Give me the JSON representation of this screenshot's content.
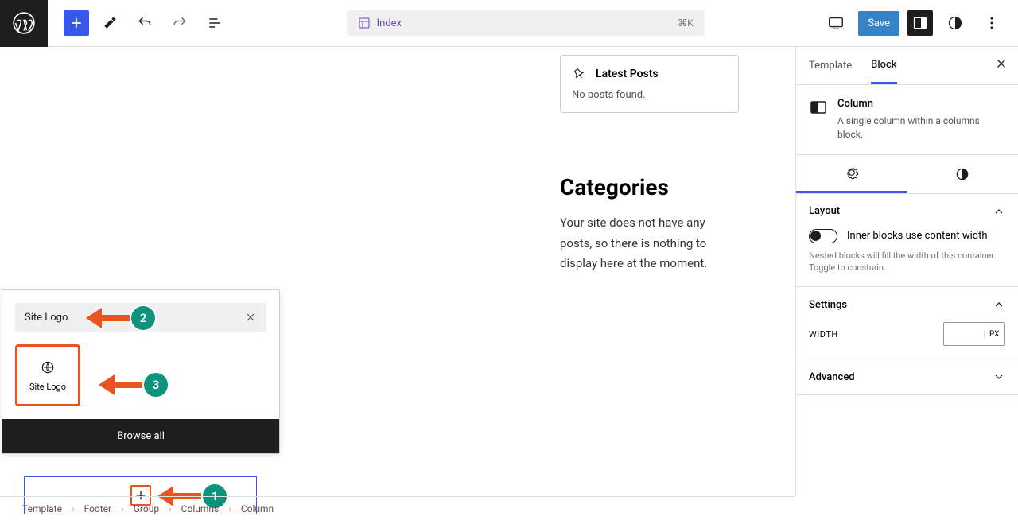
{
  "header": {
    "template_name": "Index",
    "kbd_shortcut": "⌘K",
    "save_label": "Save"
  },
  "canvas": {
    "latest_posts": {
      "title": "Latest Posts",
      "body": "No posts found."
    },
    "categories": {
      "title": "Categories",
      "body": "Your site does not have any posts, so there is nothing to display here at the moment."
    }
  },
  "inserter": {
    "search_value": "Site Logo",
    "result_block_label": "Site Logo",
    "browse_all_label": "Browse all"
  },
  "annotations": {
    "one": "1",
    "two": "2",
    "three": "3"
  },
  "sidebar": {
    "tab_template": "Template",
    "tab_block": "Block",
    "block_title": "Column",
    "block_desc": "A single column within a columns block.",
    "sections": {
      "layout_title": "Layout",
      "layout_toggle_label": "Inner blocks use content width",
      "layout_help": "Nested blocks will fill the width of this container. Toggle to constrain.",
      "settings_title": "Settings",
      "width_label": "WIDTH",
      "width_unit": "PX",
      "advanced_title": "Advanced"
    }
  },
  "breadcrumb": [
    "Template",
    "Footer",
    "Group",
    "Columns",
    "Column"
  ]
}
